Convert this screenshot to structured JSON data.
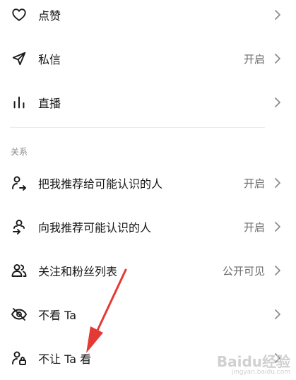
{
  "top_items": [
    {
      "label": "点赞",
      "value": "",
      "icon": "heart-icon"
    },
    {
      "label": "私信",
      "value": "开启",
      "icon": "send-icon"
    },
    {
      "label": "直播",
      "value": "",
      "icon": "live-bars-icon"
    }
  ],
  "relations": {
    "section_title": "关系",
    "items": [
      {
        "label": "把我推荐给可能认识的人",
        "value": "开启",
        "icon": "share-person-icon"
      },
      {
        "label": "向我推荐可能认识的人",
        "value": "开启",
        "icon": "person-recommend-icon"
      },
      {
        "label": "关注和粉丝列表",
        "value": "公开可见",
        "icon": "people-icon"
      },
      {
        "label": "不看 Ta",
        "value": "",
        "icon": "eye-off-icon"
      },
      {
        "label": "不让 Ta 看",
        "value": "",
        "icon": "person-lock-icon"
      }
    ]
  },
  "watermark": {
    "brand": "Baidu经验",
    "url": "jingyan.baidu.com"
  },
  "colors": {
    "annotation_arrow": "#e53935"
  }
}
